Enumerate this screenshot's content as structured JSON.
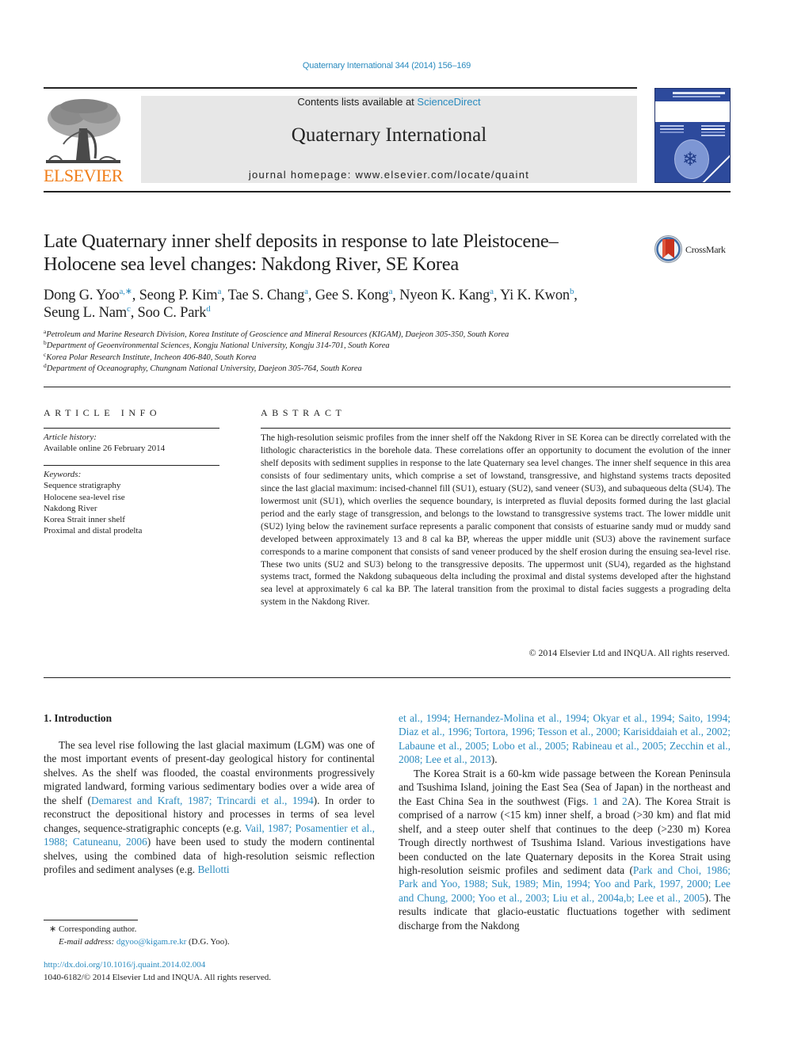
{
  "journal_ref": "Quaternary International 344 (2014) 156–169",
  "masthead": {
    "contents_prefix": "Contents lists available at ",
    "contents_link": "ScienceDirect",
    "journal_name": "Quaternary International",
    "homepage": "journal homepage: www.elsevier.com/locate/quaint",
    "publisher_logo_text": "ELSEVIER"
  },
  "article": {
    "title_line1": "Late Quaternary inner shelf deposits in response to late Pleistocene–",
    "title_line2": "Holocene sea level changes: Nakdong River, SE Korea",
    "crossmark_label": "CrossMark",
    "authors": [
      {
        "name": "Dong G. Yoo",
        "aff": "a,∗",
        "sep": ", "
      },
      {
        "name": "Seong P. Kim",
        "aff": "a",
        "sep": ", "
      },
      {
        "name": "Tae S. Chang",
        "aff": "a",
        "sep": ", "
      },
      {
        "name": "Gee S. Kong",
        "aff": "a",
        "sep": ", "
      },
      {
        "name": "Nyeon K. Kang",
        "aff": "a",
        "sep": ", "
      },
      {
        "name": "Yi K. Kwon",
        "aff": "b",
        "sep": ","
      },
      {
        "name": "Seung L. Nam",
        "aff": "c",
        "sep": ", "
      },
      {
        "name": "Soo C. Park",
        "aff": "d",
        "sep": ""
      }
    ],
    "affiliations": [
      {
        "key": "a",
        "text": "Petroleum and Marine Research Division, Korea Institute of Geoscience and Mineral Resources (KIGAM), Daejeon 305-350, South Korea"
      },
      {
        "key": "b",
        "text": "Department of Geoenvironmental Sciences, Kongju National University, Kongju 314-701, South Korea"
      },
      {
        "key": "c",
        "text": "Korea Polar Research Institute, Incheon 406-840, South Korea"
      },
      {
        "key": "d",
        "text": "Department of Oceanography, Chungnam National University, Daejeon 305-764, South Korea"
      }
    ]
  },
  "article_info": {
    "heading": "ARTICLE INFO",
    "history_label": "Article history:",
    "history_value": "Available online 26 February 2014",
    "keywords_label": "Keywords:",
    "keywords": [
      "Sequence stratigraphy",
      "Holocene sea-level rise",
      "Nakdong River",
      "Korea Strait inner shelf",
      "Proximal and distal prodelta"
    ]
  },
  "abstract": {
    "heading": "ABSTRACT",
    "text": "The high-resolution seismic profiles from the inner shelf off the Nakdong River in SE Korea can be directly correlated with the lithologic characteristics in the borehole data. These correlations offer an opportunity to document the evolution of the inner shelf deposits with sediment supplies in response to the late Quaternary sea level changes. The inner shelf sequence in this area consists of four sedimentary units, which comprise a set of lowstand, transgressive, and highstand systems tracts deposited since the last glacial maximum: incised-channel fill (SU1), estuary (SU2), sand veneer (SU3), and subaqueous delta (SU4). The lowermost unit (SU1), which overlies the sequence boundary, is interpreted as fluvial deposits formed during the last glacial period and the early stage of transgression, and belongs to the lowstand to transgressive systems tract. The lower middle unit (SU2) lying below the ravinement surface represents a paralic component that consists of estuarine sandy mud or muddy sand developed between approxi­mately 13 and 8 cal ka BP, whereas the upper middle unit (SU3) above the ravinement surface corre­sponds to a marine component that consists of sand veneer produced by the shelf erosion during the ensuing sea-level rise. These two units (SU2 and SU3) belong to the transgressive deposits. The upper­most unit (SU4), regarded as the highstand systems tract, formed the Nakdong subaqueous delta including the proximal and distal systems developed after the highstand sea level at approximately 6 cal ka BP. The lateral transition from the proximal to distal facies suggests a prograding delta system in the Nakdong River.",
    "copyright": "© 2014 Elsevier Ltd and INQUA. All rights reserved."
  },
  "intro": {
    "heading": "1.  Introduction",
    "left_para": [
      {
        "t": "The sea level rise following the last glacial maximum (LGM) was one of the most important events of present-day geological history for continental shelves. As the shelf was flooded, the coastal envi­ronments progressively migrated landward, forming various sedi­mentary bodies over a wide area of the shelf (",
        "link": false
      },
      {
        "t": "Demarest and Kraft, 1987; Trincardi et al., 1994",
        "link": true
      },
      {
        "t": "). In order to reconstruct the deposi­tional history and processes in terms of sea level changes, sequence-stratigraphic concepts (e.g. ",
        "link": false
      },
      {
        "t": "Vail, 1987; Posamentier et al., 1988; Catuneanu, 2006",
        "link": true
      },
      {
        "t": ") have been used to study the modern continental shelves, using the combined data of high-resolution seismic reflection profiles and sediment analyses (e.g. ",
        "link": false
      },
      {
        "t": "Bellotti",
        "link": true
      }
    ],
    "right_para1": [
      {
        "t": "et al., 1994; Hernandez-Molina et al., 1994; Okyar et al., 1994; Saito, 1994; Diaz et al., 1996; Tortora, 1996; Tesson et al., 2000; Karisiddaiah et al., 2002; Labaune et al., 2005; Lobo et al., 2005; Rabineau et al., 2005; Zecchin et al., 2008; Lee et al., 2013",
        "link": true
      },
      {
        "t": ").",
        "link": false
      }
    ],
    "right_para2": [
      {
        "t": "The Korea Strait is a 60-km wide passage between the Korean Peninsula and Tsushima Island, joining the East Sea (Sea of Japan) in the northeast and the East China Sea in the southwest (Figs. ",
        "link": false
      },
      {
        "t": "1",
        "link": true
      },
      {
        "t": " and ",
        "link": false
      },
      {
        "t": "2",
        "link": true
      },
      {
        "t": "A). The Korea Strait is comprised of a narrow (<15 km) inner shelf, a broad (>30 km) and flat mid shelf, and a steep outer shelf that continues to the deep (>230 m) Korea Trough directly northwest of Tsushima Island. Various investigations have been conducted on the late Quaternary deposits in the Korea Strait using high-resolution seismic profiles and sediment data (",
        "link": false
      },
      {
        "t": "Park and Choi, 1986; Park and Yoo, 1988; Suk, 1989; Min, 1994; Yoo and Park, 1997, 2000; Lee and Chung, 2000; Yoo et al., 2003; Liu et al., 2004a,b; Lee et al., 2005",
        "link": true
      },
      {
        "t": "). The results indicate that glacio-eustatic fluctuations together with sediment discharge from the Nakdong",
        "link": false
      }
    ]
  },
  "footnotes": {
    "corresponding_marker": "∗",
    "corresponding_text": "Corresponding author.",
    "email_label": "E-mail address:",
    "email": "dgyoo@kigam.re.kr",
    "email_suffix": " (D.G. Yoo).",
    "doi": "http://dx.doi.org/10.1016/j.quaint.2014.02.004",
    "issn_line": "1040-6182/© 2014 Elsevier Ltd and INQUA. All rights reserved."
  },
  "colors": {
    "link": "#2a8bbf",
    "elsevier_orange": "#f07d18",
    "masthead_bg": "#e7e7e7",
    "cover_blue": "#2d4a9c"
  }
}
